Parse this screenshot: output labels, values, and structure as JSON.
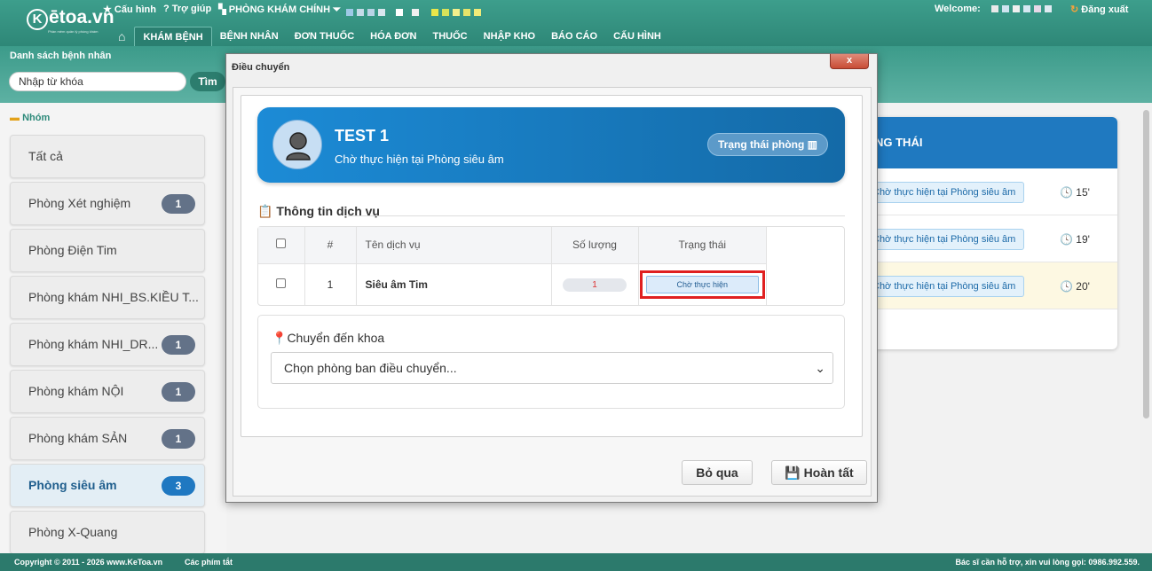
{
  "header": {
    "logo": "Kêtoa.vn",
    "logo_tagline": "Phần mềm quản lý phòng khám",
    "links": [
      "Cấu hình",
      "Trợ giúp",
      "PHÒNG KHÁM CHÍNH"
    ],
    "welcome": "Welcome:",
    "logout": "Đăng xuất"
  },
  "nav": {
    "items": [
      "KHÁM BỆNH",
      "BỆNH NHÂN",
      "ĐƠN THUỐC",
      "HÓA ĐƠN",
      "THUỐC",
      "NHẬP KHO",
      "BÁO CÁO",
      "CẤU HÌNH"
    ],
    "active": "KHÁM BỆNH"
  },
  "patients": {
    "title": "Danh sách bệnh nhân",
    "search_placeholder": "Nhập từ khóa",
    "search_button": "Tìm"
  },
  "groups": {
    "title": "Nhóm",
    "items": [
      {
        "label": "Tất cả",
        "count": ""
      },
      {
        "label": "Phòng Xét nghiệm",
        "count": "1"
      },
      {
        "label": "Phòng Điện Tim",
        "count": ""
      },
      {
        "label": "Phòng khám NHI_BS.KIỀU T...",
        "count": ""
      },
      {
        "label": "Phòng khám NHI_DR...",
        "count": "1"
      },
      {
        "label": "Phòng khám NỘI",
        "count": "1"
      },
      {
        "label": "Phòng khám SẢN",
        "count": "1"
      },
      {
        "label": "Phòng siêu âm",
        "count": "3"
      },
      {
        "label": "Phòng X-Quang",
        "count": ""
      }
    ],
    "active_index": 7
  },
  "queue": {
    "header": "NG THÁI",
    "rows": [
      {
        "status": "Chờ thực hiện tại Phòng siêu âm",
        "time": "15'"
      },
      {
        "status": "Chờ thực hiện tại Phòng siêu âm",
        "time": "19'"
      },
      {
        "status": "Chờ thực hiện tại Phòng siêu âm",
        "time": "20'"
      }
    ]
  },
  "footer": {
    "copyright": "Copyright © 2011 - 2026 www.KeToa.vn",
    "shortcuts": "Các phím tắt",
    "support": "Bác sĩ cần hỗ trợ, xin vui lòng gọi: 0986.992.559."
  },
  "modal": {
    "title": "Điều chuyển",
    "close": "x",
    "patient_name": "TEST 1",
    "patient_status": "Chờ thực hiện tại Phòng siêu âm",
    "room_status_button": "Trạng thái phòng",
    "service_section_title": "Thông tin dịch vụ",
    "table_headers": [
      "#",
      "Tên dịch vụ",
      "Số lượng",
      "Trạng thái"
    ],
    "services": [
      {
        "index": "1",
        "name": "Siêu âm Tim",
        "quantity": "1",
        "status": "Chờ thực hiện"
      }
    ],
    "transfer_label": "Chuyển đến khoa",
    "transfer_placeholder": "Chọn phòng ban điều chuyển...",
    "cancel_button": "Bỏ qua",
    "done_button": "Hoàn tất"
  },
  "colors": {
    "header_teal": "#2e8777",
    "primary_blue": "#1f79c0",
    "highlight_red": "#e02020"
  }
}
